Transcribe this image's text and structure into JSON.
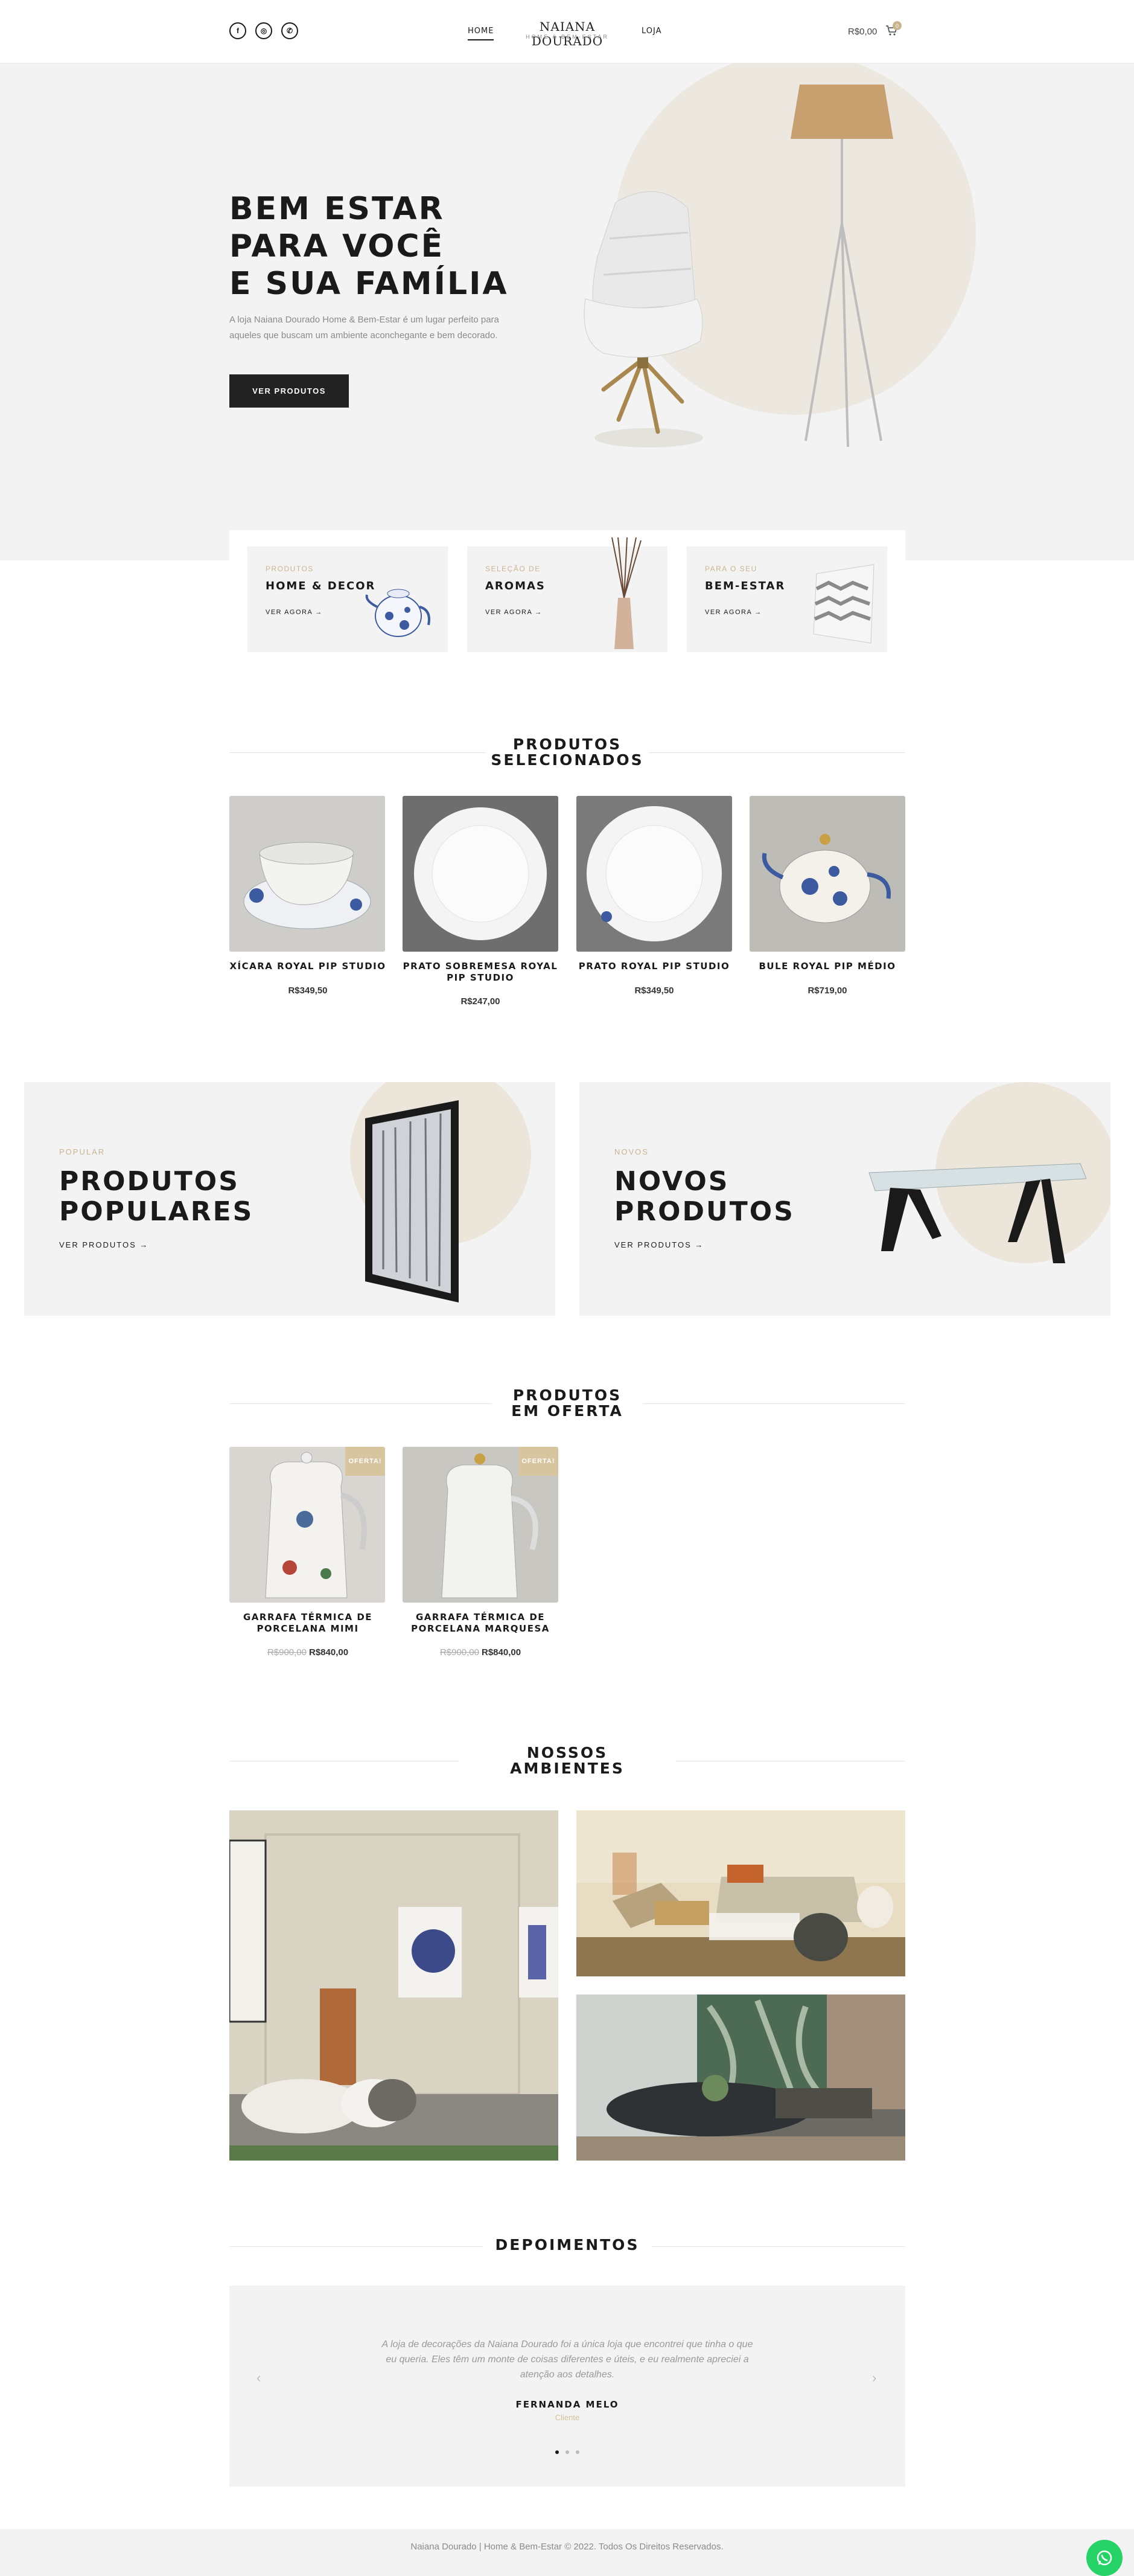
{
  "header": {
    "social": [
      {
        "icon": "facebook-icon",
        "glyph": "f"
      },
      {
        "icon": "instagram-icon",
        "glyph": "◎"
      },
      {
        "icon": "whatsapp-icon",
        "glyph": "✆"
      }
    ],
    "nav_home": "HOME",
    "nav_shop": "LOJA",
    "logo_name": "NAIANA DOURADO",
    "logo_sub": "HOME & BEM-ESTAR",
    "cart_total": "R$0,00",
    "cart_count": "0"
  },
  "hero": {
    "title_line1": "BEM ESTAR",
    "title_line2": "PARA VOCÊ",
    "title_line3": "E SUA FAMÍLIA",
    "description": "A loja Naiana Dourado Home & Bem-Estar é um lugar perfeito para aqueles que buscam um ambiente aconchegante e bem decorado.",
    "button": "VER PRODUTOS"
  },
  "categories": [
    {
      "subtitle": "PRODUTOS",
      "title": "HOME & DECOR",
      "link": "VER AGORA →"
    },
    {
      "subtitle": "SELEÇÃO DE",
      "title": "AROMAS",
      "link": "VER AGORA →"
    },
    {
      "subtitle": "PARA O SEU",
      "title": "BEM-ESTAR",
      "link": "VER AGORA →"
    }
  ],
  "featured": {
    "title_line1": "PRODUTOS",
    "title_line2": "SELECIONADOS",
    "products": [
      {
        "name_line1": "XÍCARA ROYAL PIP STUDIO",
        "name_line2": "",
        "price": "R$349,50"
      },
      {
        "name_line1": "PRATO SOBREMESA ROYAL",
        "name_line2": "PIP STUDIO",
        "price": "R$247,00"
      },
      {
        "name_line1": "PRATO ROYAL PIP STUDIO",
        "name_line2": "",
        "price": "R$349,50"
      },
      {
        "name_line1": "BULE ROYAL PIP MÉDIO",
        "name_line2": "",
        "price": "R$719,00"
      }
    ]
  },
  "promos": [
    {
      "subtitle": "POPULAR",
      "title_line1": "PRODUTOS",
      "title_line2": "POPULARES",
      "link": "VER PRODUTOS →"
    },
    {
      "subtitle": "NOVOS",
      "title_line1": "NOVOS",
      "title_line2": "PRODUTOS",
      "link": "VER PRODUTOS →"
    }
  ],
  "offers": {
    "title_line1": "PRODUTOS",
    "title_line2": "EM OFERTA",
    "products": [
      {
        "badge": "OFERTA!",
        "name_line1": "GARRAFA TÉRMICA DE",
        "name_line2": "PORCELANA MIMI",
        "old_price": "R$900,00",
        "price": "R$840,00"
      },
      {
        "badge": "OFERTA!",
        "name_line1": "GARRAFA TÉRMICA DE",
        "name_line2": "PORCELANA MARQUESA",
        "old_price": "R$900,00",
        "price": "R$840,00"
      }
    ]
  },
  "environments": {
    "title_line1": "NOSSOS",
    "title_line2": "AMBIENTES"
  },
  "testimonials": {
    "title": "DEPOIMENTOS",
    "text": "A loja de decorações da Naiana Dourado foi a única loja que encontrei que tinha o que eu queria. Eles têm um monte de coisas diferentes e úteis, e eu realmente apreciei a atenção aos detalhes.",
    "name": "FERNANDA MELO",
    "role": "Cliente"
  },
  "footer": {
    "text": "Naiana Dourado | Home & Bem-Estar © 2022. Todos Os Direitos Reservados."
  },
  "colors": {
    "accent": "#c9b48f",
    "dark": "#222222",
    "panel": "#f3f3f3",
    "whatsapp": "#25d366"
  }
}
